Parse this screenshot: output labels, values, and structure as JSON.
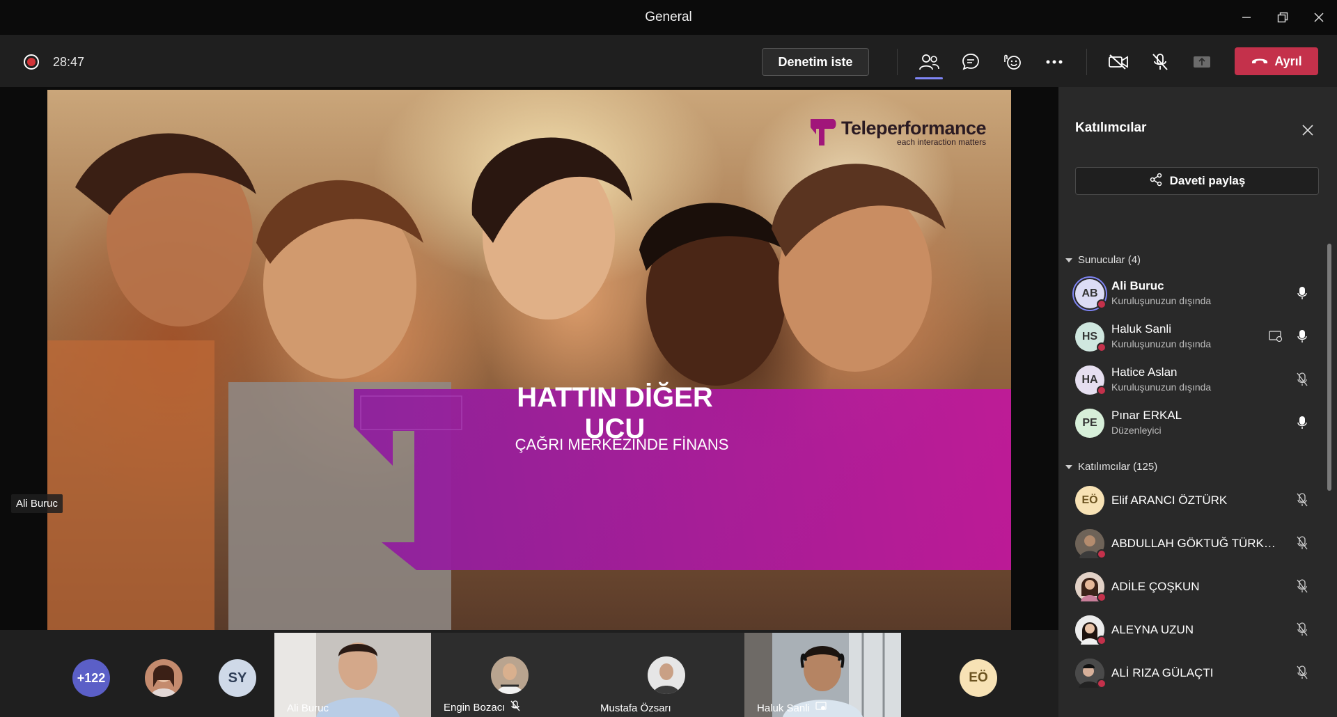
{
  "window": {
    "title": "General"
  },
  "toolbar": {
    "timer": "28:47",
    "help_label": "Denetim iste",
    "leave_label": "Ayrıl"
  },
  "slide": {
    "logo_name": "Teleperformance",
    "logo_tagline": "each interaction matters",
    "title": "HATTIN DİĞER UCU",
    "subtitle": "ÇAĞRI MERKEZİNDE FİNANS",
    "presenter": "Ali Buruc",
    "colors": {
      "banner_start": "#8e1f9e",
      "banner_end": "#c0189b",
      "brand": "#a1167a"
    }
  },
  "strip": {
    "overflow_count": "+122",
    "initials_sy": "SY",
    "initials_eo": "EÖ",
    "tiles": [
      {
        "name": "Ali Buruc"
      },
      {
        "name": "Engin Bozacı"
      },
      {
        "name": "Mustafa Özsarı"
      },
      {
        "name": "Haluk Sanli"
      }
    ]
  },
  "sidebar": {
    "title": "Katılımcılar",
    "share_label": "Daveti paylaş",
    "presenters_header": "Sunucular (4)",
    "attendees_header": "Katılımcılar (125)",
    "presenters": [
      {
        "initials": "AB",
        "name": "Ali Buruc",
        "sub": "Kuruluşunuzun dışında",
        "avatar_color": "#dcdcf5",
        "mic": "mic-on-icon"
      },
      {
        "initials": "HS",
        "name": "Haluk Sanli",
        "sub": "Kuruluşunuzun dışında",
        "avatar_color": "#cfe7df",
        "mic": "mic-on-icon"
      },
      {
        "initials": "HA",
        "name": "Hatice Aslan",
        "sub": "Kuruluşunuzun dışında",
        "avatar_color": "#e6dff0",
        "mic": "mic-off-icon"
      },
      {
        "initials": "PE",
        "name": "Pınar ERKAL",
        "sub": "Düzenleyici",
        "avatar_color": "#d7efd9",
        "mic": "mic-on-icon"
      }
    ],
    "attendees": [
      {
        "initials": "EÖ",
        "name": "Elif ARANCI ÖZTÜRK"
      },
      {
        "name": "ABDULLAH GÖKTUĞ TÜRKO..."
      },
      {
        "name": "ADİLE ÇOŞKUN"
      },
      {
        "name": "ALEYNA UZUN"
      },
      {
        "name": "ALİ RIZA GÜLAÇTI"
      }
    ]
  }
}
